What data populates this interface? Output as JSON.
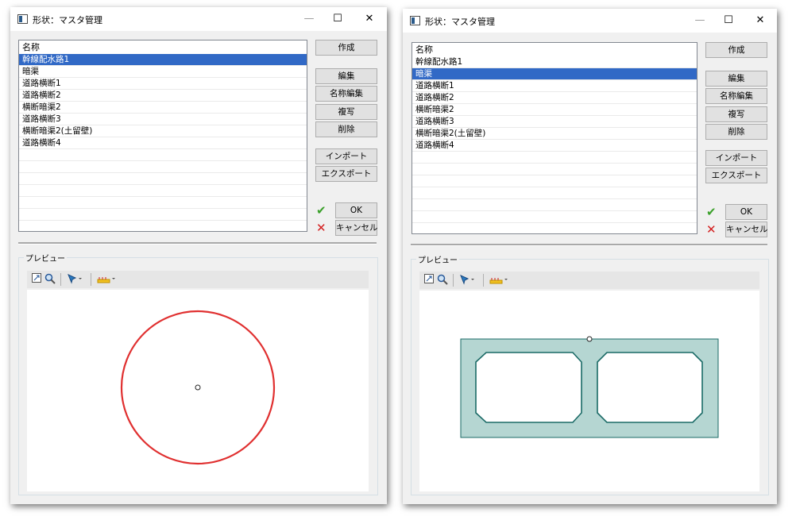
{
  "window1": {
    "title": "形状：マスタ管理",
    "controls": {
      "minimize": "—",
      "maximize": "☐",
      "close": "✕"
    },
    "list": {
      "header": "名称",
      "items": [
        "幹線配水路1",
        "暗渠",
        "道路横断1",
        "道路横断2",
        "横断暗渠2",
        "道路横断3",
        "横断暗渠2(土留壁)",
        "道路横断4"
      ],
      "selected_index": 0
    },
    "buttons": {
      "create": "作成",
      "edit": "編集",
      "rename": "名称編集",
      "copy": "複写",
      "delete": "削除",
      "import": "インポート",
      "export": "エクスポート",
      "ok": "OK",
      "cancel": "キャンセル"
    },
    "preview": {
      "label": "プレビュー",
      "shape": "circle",
      "shape_color": "#e03030"
    }
  },
  "window2": {
    "title": "形状：マスタ管理",
    "controls": {
      "minimize": "—",
      "maximize": "☐",
      "close": "✕"
    },
    "list": {
      "header": "名称",
      "items": [
        "幹線配水路1",
        "暗渠",
        "道路横断1",
        "道路横断2",
        "横断暗渠2",
        "道路横断3",
        "横断暗渠2(土留壁)",
        "道路横断4"
      ],
      "selected_index": 1
    },
    "buttons": {
      "create": "作成",
      "edit": "編集",
      "rename": "名称編集",
      "copy": "複写",
      "delete": "削除",
      "import": "インポート",
      "export": "エクスポート",
      "ok": "OK",
      "cancel": "キャンセル"
    },
    "preview": {
      "label": "プレビュー",
      "shape": "double-box-culvert",
      "fill_color": "#b5d6d2",
      "stroke_color": "#1a6a66"
    }
  },
  "icons": {
    "ok": "check-icon",
    "cancel": "x-mark-icon",
    "zoom_fit": "zoom-fit-icon",
    "zoom": "magnifier-icon",
    "select": "select-arrow-icon",
    "measure": "ruler-icon"
  },
  "colors": {
    "selection": "#3169c6",
    "window_bg": "#f0f0f0",
    "button_bg": "#e1e1e1"
  }
}
